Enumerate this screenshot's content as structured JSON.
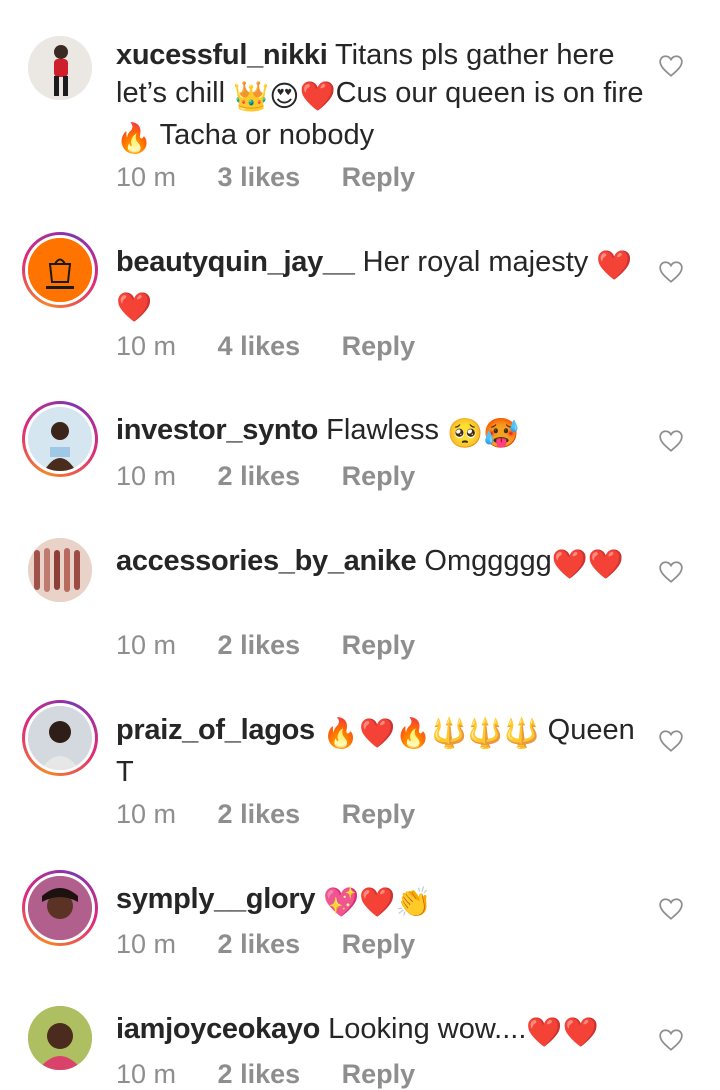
{
  "comments": [
    {
      "user": "xucessful_nikki",
      "text_parts": [
        "Titans pls gather here let’s chill ",
        "👑",
        "😍",
        "❤️",
        "Cus our queen is on fire ",
        "🔥",
        " Tacha or nobody"
      ],
      "time": "10 m",
      "likes": "3 likes",
      "reply": "Reply"
    },
    {
      "user": "beautyquin_jay__",
      "text_parts": [
        "Her royal majesty ",
        "❤️",
        "❤️"
      ],
      "time": "10 m",
      "likes": "4 likes",
      "reply": "Reply"
    },
    {
      "user": "investor_synto",
      "text_parts": [
        "Flawless ",
        "🥺",
        "🥵"
      ],
      "time": "10 m",
      "likes": "2 likes",
      "reply": "Reply"
    },
    {
      "user": "accessories_by_anike",
      "text_parts": [
        "Omggggg",
        "❤️",
        "❤️"
      ],
      "time": "10 m",
      "likes": "2 likes",
      "reply": "Reply"
    },
    {
      "user": "praiz_of_lagos",
      "text_parts": [
        "🔥",
        "❤️",
        "🔥",
        "🔱",
        "🔱",
        "🔱",
        " Queen T"
      ],
      "time": "10 m",
      "likes": "2 likes",
      "reply": "Reply"
    },
    {
      "user": "symply__glory",
      "text_parts": [
        "💖",
        "❤️",
        "👏"
      ],
      "time": "10 m",
      "likes": "2 likes",
      "reply": "Reply"
    },
    {
      "user": "iamjoyceokayo",
      "text_parts": [
        "Looking wow....",
        "❤️",
        "❤️"
      ],
      "time": "10 m",
      "likes": "2 likes",
      "reply": "Reply"
    }
  ],
  "icons": {
    "like": "heart-outline-icon"
  },
  "colors": {
    "meta": "#8e8e8e",
    "story_ring_start": "#f58529",
    "story_ring_end": "#dd2a7b",
    "heart": "#ed1c24"
  }
}
